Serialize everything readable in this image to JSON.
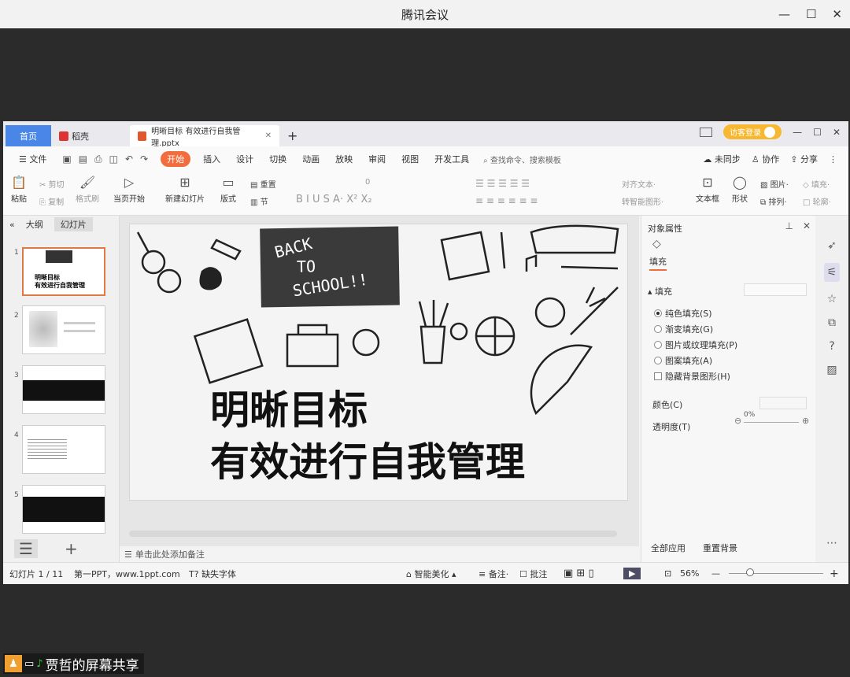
{
  "window": {
    "title": "腾讯会议",
    "minimize": "—",
    "maximize": "☐",
    "close": "✕"
  },
  "tabs": {
    "home": "首页",
    "daoke": "稻壳",
    "doc": "明晰目标 有效进行自我管理.pptx",
    "doc_close": "✕",
    "add": "+"
  },
  "tabbar_right": {
    "login": "访客登录"
  },
  "menubar": {
    "file": "文件",
    "items": [
      "开始",
      "插入",
      "设计",
      "切换",
      "动画",
      "放映",
      "审阅",
      "视图",
      "开发工具"
    ],
    "search": "查找命令、搜索模板",
    "sync": "未同步",
    "collab": "协作",
    "share": "分享"
  },
  "ribbon": {
    "paste": "粘贴",
    "cut": "剪切",
    "copy": "复制",
    "format_painter": "格式刷",
    "from_current": "当页开始",
    "new_slide": "新建幻灯片",
    "layout": "版式",
    "section": "节",
    "reset": "重置",
    "font_size": "0",
    "align_text": "对齐文本",
    "to_smart": "转智能图形",
    "textbox": "文本框",
    "shape": "形状",
    "picture": "图片",
    "arrange": "排列",
    "fill": "填充",
    "outline": "轮廓"
  },
  "leftpane": {
    "tab_outline": "大纲",
    "tab_slides": "幻灯片",
    "thumbs": [
      {
        "num": "1",
        "text": "明晰目标\n有效进行自我管理"
      },
      {
        "num": "2",
        "text": ""
      },
      {
        "num": "3",
        "text": ""
      },
      {
        "num": "4",
        "text": ""
      },
      {
        "num": "5",
        "text": ""
      }
    ],
    "menu_icon": "☰",
    "add_icon": "+"
  },
  "slide": {
    "chalk": [
      "BACK",
      "TO",
      "SCHOOL!!"
    ],
    "title_line1": "明晰目标",
    "title_line2": "有效进行自我管理"
  },
  "notes": "单击此处添加备注",
  "rightpane": {
    "title": "对象属性",
    "tab_fill": "填充",
    "section_fill": "填充",
    "options": [
      "纯色填充(S)",
      "渐变填充(G)",
      "图片或纹理填充(P)",
      "图案填充(A)"
    ],
    "hide_bg": "隐藏背景图形(H)",
    "color_label": "颜色(C)",
    "transparency_label": "透明度(T)",
    "transparency_value": "0%",
    "apply_all": "全部应用",
    "reset_bg": "重置背景"
  },
  "statusbar": {
    "slide_counter": "幻灯片 1 / 11",
    "source": "第一PPT，www.1ppt.com",
    "missing_font": "缺失字体",
    "beautify": "智能美化",
    "notes": "备注",
    "comments": "批注",
    "zoom": "56%",
    "play": "▶"
  },
  "screen_share": {
    "label": "贾哲的屏幕共享"
  },
  "colors": {
    "accent": "#f26d3d",
    "home_tab": "#4a86e8",
    "login": "#f7b731",
    "bg": "#2b2b2b"
  }
}
